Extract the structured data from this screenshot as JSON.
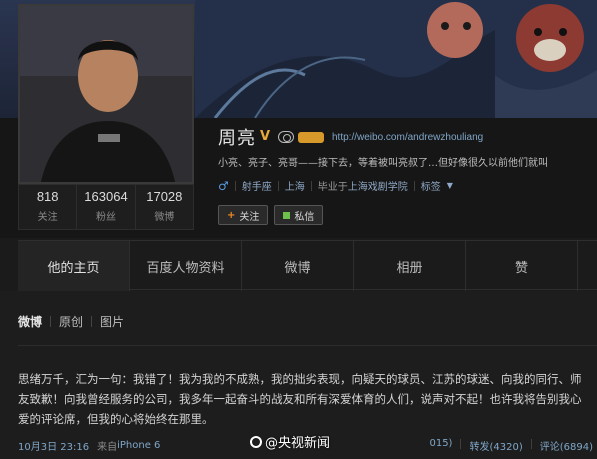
{
  "profile": {
    "name": "周亮",
    "verified_badge": "V",
    "url": "http://weibo.com/andrewzhouliang",
    "bio": "小亮、亮子、亮哥——接下去，等着被叫亮叔了…但好像很久以前他们就叫",
    "gender_icon": "male-symbol-icon",
    "meta": {
      "follow_status": "射手座",
      "location": "上海",
      "school_prefix": "毕业于",
      "school": "上海戏剧学院",
      "tags": "标签"
    },
    "buttons": {
      "follow": "关注",
      "message": "私信"
    }
  },
  "stats": [
    {
      "value": "818",
      "label": "关注"
    },
    {
      "value": "163064",
      "label": "粉丝"
    },
    {
      "value": "17028",
      "label": "微博"
    }
  ],
  "tabs": [
    "他的主页",
    "百度人物资料",
    "微博",
    "相册",
    "赞"
  ],
  "feed": {
    "sub_tabs": [
      "微博",
      "原创",
      "图片"
    ],
    "post_text": "思绪万千，汇为一句：我错了！我为我的不成熟，我的拙劣表现，向疑天的球员、江苏的球迷、向我的同行、师友致歉！向我曾经服务的公司，我多年一起奋斗的战友和所有深爱体育的人们，说声对不起！也许我将告别我心爱的评论席，但我的心将始终在那里。",
    "time": "10月3日 23:16",
    "device_prefix": "来自",
    "device": "iPhone 6",
    "likes_partial": "015)",
    "repost": "转发(4320)",
    "comment": "评论(6894)"
  },
  "watermark": "@央视新闻",
  "colors": {
    "accent_link": "#7fa6c8",
    "follow_plus": "#f08b27",
    "badge_gold": "#d79a2a"
  }
}
